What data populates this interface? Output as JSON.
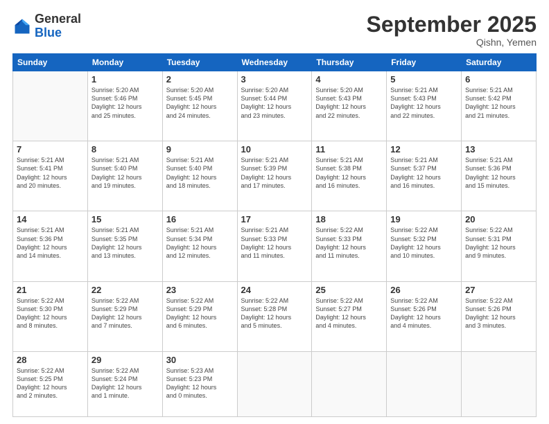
{
  "header": {
    "logo_general": "General",
    "logo_blue": "Blue",
    "month_title": "September 2025",
    "subtitle": "Qishn, Yemen"
  },
  "days_of_week": [
    "Sunday",
    "Monday",
    "Tuesday",
    "Wednesday",
    "Thursday",
    "Friday",
    "Saturday"
  ],
  "weeks": [
    [
      {
        "day": "",
        "info": ""
      },
      {
        "day": "1",
        "info": "Sunrise: 5:20 AM\nSunset: 5:46 PM\nDaylight: 12 hours\nand 25 minutes."
      },
      {
        "day": "2",
        "info": "Sunrise: 5:20 AM\nSunset: 5:45 PM\nDaylight: 12 hours\nand 24 minutes."
      },
      {
        "day": "3",
        "info": "Sunrise: 5:20 AM\nSunset: 5:44 PM\nDaylight: 12 hours\nand 23 minutes."
      },
      {
        "day": "4",
        "info": "Sunrise: 5:20 AM\nSunset: 5:43 PM\nDaylight: 12 hours\nand 22 minutes."
      },
      {
        "day": "5",
        "info": "Sunrise: 5:21 AM\nSunset: 5:43 PM\nDaylight: 12 hours\nand 22 minutes."
      },
      {
        "day": "6",
        "info": "Sunrise: 5:21 AM\nSunset: 5:42 PM\nDaylight: 12 hours\nand 21 minutes."
      }
    ],
    [
      {
        "day": "7",
        "info": "Sunrise: 5:21 AM\nSunset: 5:41 PM\nDaylight: 12 hours\nand 20 minutes."
      },
      {
        "day": "8",
        "info": "Sunrise: 5:21 AM\nSunset: 5:40 PM\nDaylight: 12 hours\nand 19 minutes."
      },
      {
        "day": "9",
        "info": "Sunrise: 5:21 AM\nSunset: 5:40 PM\nDaylight: 12 hours\nand 18 minutes."
      },
      {
        "day": "10",
        "info": "Sunrise: 5:21 AM\nSunset: 5:39 PM\nDaylight: 12 hours\nand 17 minutes."
      },
      {
        "day": "11",
        "info": "Sunrise: 5:21 AM\nSunset: 5:38 PM\nDaylight: 12 hours\nand 16 minutes."
      },
      {
        "day": "12",
        "info": "Sunrise: 5:21 AM\nSunset: 5:37 PM\nDaylight: 12 hours\nand 16 minutes."
      },
      {
        "day": "13",
        "info": "Sunrise: 5:21 AM\nSunset: 5:36 PM\nDaylight: 12 hours\nand 15 minutes."
      }
    ],
    [
      {
        "day": "14",
        "info": "Sunrise: 5:21 AM\nSunset: 5:36 PM\nDaylight: 12 hours\nand 14 minutes."
      },
      {
        "day": "15",
        "info": "Sunrise: 5:21 AM\nSunset: 5:35 PM\nDaylight: 12 hours\nand 13 minutes."
      },
      {
        "day": "16",
        "info": "Sunrise: 5:21 AM\nSunset: 5:34 PM\nDaylight: 12 hours\nand 12 minutes."
      },
      {
        "day": "17",
        "info": "Sunrise: 5:21 AM\nSunset: 5:33 PM\nDaylight: 12 hours\nand 11 minutes."
      },
      {
        "day": "18",
        "info": "Sunrise: 5:22 AM\nSunset: 5:33 PM\nDaylight: 12 hours\nand 11 minutes."
      },
      {
        "day": "19",
        "info": "Sunrise: 5:22 AM\nSunset: 5:32 PM\nDaylight: 12 hours\nand 10 minutes."
      },
      {
        "day": "20",
        "info": "Sunrise: 5:22 AM\nSunset: 5:31 PM\nDaylight: 12 hours\nand 9 minutes."
      }
    ],
    [
      {
        "day": "21",
        "info": "Sunrise: 5:22 AM\nSunset: 5:30 PM\nDaylight: 12 hours\nand 8 minutes."
      },
      {
        "day": "22",
        "info": "Sunrise: 5:22 AM\nSunset: 5:29 PM\nDaylight: 12 hours\nand 7 minutes."
      },
      {
        "day": "23",
        "info": "Sunrise: 5:22 AM\nSunset: 5:29 PM\nDaylight: 12 hours\nand 6 minutes."
      },
      {
        "day": "24",
        "info": "Sunrise: 5:22 AM\nSunset: 5:28 PM\nDaylight: 12 hours\nand 5 minutes."
      },
      {
        "day": "25",
        "info": "Sunrise: 5:22 AM\nSunset: 5:27 PM\nDaylight: 12 hours\nand 4 minutes."
      },
      {
        "day": "26",
        "info": "Sunrise: 5:22 AM\nSunset: 5:26 PM\nDaylight: 12 hours\nand 4 minutes."
      },
      {
        "day": "27",
        "info": "Sunrise: 5:22 AM\nSunset: 5:26 PM\nDaylight: 12 hours\nand 3 minutes."
      }
    ],
    [
      {
        "day": "28",
        "info": "Sunrise: 5:22 AM\nSunset: 5:25 PM\nDaylight: 12 hours\nand 2 minutes."
      },
      {
        "day": "29",
        "info": "Sunrise: 5:22 AM\nSunset: 5:24 PM\nDaylight: 12 hours\nand 1 minute."
      },
      {
        "day": "30",
        "info": "Sunrise: 5:23 AM\nSunset: 5:23 PM\nDaylight: 12 hours\nand 0 minutes."
      },
      {
        "day": "",
        "info": ""
      },
      {
        "day": "",
        "info": ""
      },
      {
        "day": "",
        "info": ""
      },
      {
        "day": "",
        "info": ""
      }
    ]
  ]
}
